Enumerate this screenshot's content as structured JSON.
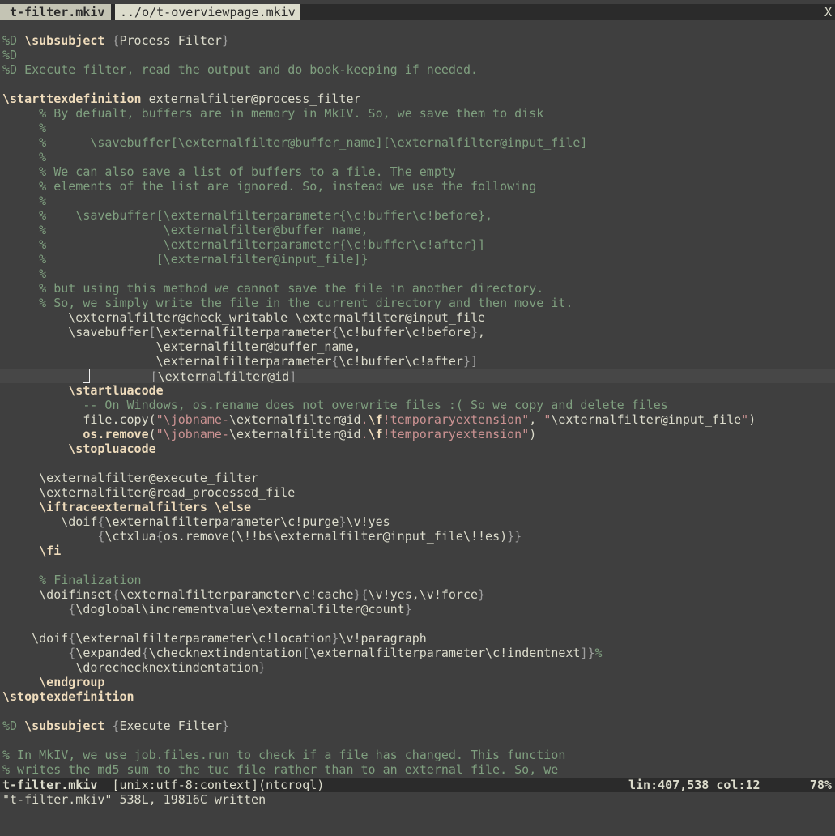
{
  "tabs": [
    {
      "label": "t-filter.mkiv",
      "active": true
    },
    {
      "label": "../o/t-overviewpage.mkiv",
      "active": false
    }
  ],
  "tab_close_label": "X",
  "colors": {
    "background": "#3f3f3f",
    "foreground": "#dcdccc",
    "comment": "#7f9f7f",
    "keyword": "#efdcbc",
    "string": "#cc9393",
    "statusline_bg": "#2b2b2b"
  },
  "lines": [
    [
      {
        "t": "%D ",
        "c": "cmt"
      },
      {
        "t": "\\subsubject",
        "c": "kw"
      },
      {
        "t": " "
      },
      {
        "t": "{",
        "c": "br"
      },
      {
        "t": "Process Filter"
      },
      {
        "t": "}",
        "c": "br"
      }
    ],
    [
      {
        "t": "%D",
        "c": "cmt"
      }
    ],
    [
      {
        "t": "%D Execute filter, read the output and do book-keeping if needed.",
        "c": "cmt"
      }
    ],
    [],
    [
      {
        "t": "\\starttexdefinition",
        "c": "kw"
      },
      {
        "t": " externalfilter@process_filter"
      }
    ],
    [
      {
        "t": "     % By defualt, buffers are in memory in MkIV. So, we save them to disk",
        "c": "cmt"
      }
    ],
    [
      {
        "t": "     %",
        "c": "cmt"
      }
    ],
    [
      {
        "t": "     %      \\savebuffer[\\externalfilter@buffer_name][\\externalfilter@input_file]",
        "c": "cmt"
      }
    ],
    [
      {
        "t": "     %",
        "c": "cmt"
      }
    ],
    [
      {
        "t": "     % We can also save a list of buffers to a file. The empty",
        "c": "cmt"
      }
    ],
    [
      {
        "t": "     % elements of the list are ignored. So, instead we use the following",
        "c": "cmt"
      }
    ],
    [
      {
        "t": "     %",
        "c": "cmt"
      }
    ],
    [
      {
        "t": "     %    \\savebuffer[\\externalfilterparameter{\\c!buffer\\c!before},",
        "c": "cmt"
      }
    ],
    [
      {
        "t": "     %                \\externalfilter@buffer_name,",
        "c": "cmt"
      }
    ],
    [
      {
        "t": "     %                \\externalfilterparameter{\\c!buffer\\c!after}]",
        "c": "cmt"
      }
    ],
    [
      {
        "t": "     %               [\\externalfilter@input_file]}",
        "c": "cmt"
      }
    ],
    [
      {
        "t": "     %",
        "c": "cmt"
      }
    ],
    [
      {
        "t": "     % but using this method we cannot save the file in another directory.",
        "c": "cmt"
      }
    ],
    [
      {
        "t": "     % So, we simply write the file in the current directory and then move it.",
        "c": "cmt"
      }
    ],
    [
      {
        "t": "         \\externalfilter@check_writable \\externalfilter@input_file"
      }
    ],
    [
      {
        "t": "         \\savebuffer"
      },
      {
        "t": "[",
        "c": "br"
      },
      {
        "t": "\\externalfilterparameter"
      },
      {
        "t": "{",
        "c": "br"
      },
      {
        "t": "\\c!buffer\\c!before"
      },
      {
        "t": "}",
        "c": "br"
      },
      {
        "t": ","
      }
    ],
    [
      {
        "t": "                     \\externalfilter@buffer_name,"
      }
    ],
    [
      {
        "t": "                     \\externalfilterparameter"
      },
      {
        "t": "{",
        "c": "br"
      },
      {
        "t": "\\c!buffer\\c!after"
      },
      {
        "t": "}]",
        "c": "br"
      }
    ],
    [
      {
        "t": "           ",
        "cursor": true
      },
      {
        "t": "        "
      },
      {
        "t": "[",
        "c": "br"
      },
      {
        "t": "\\externalfilter@id"
      },
      {
        "t": "]",
        "c": "br"
      }
    ],
    [
      {
        "t": "         "
      },
      {
        "t": "\\startluacode",
        "c": "kw"
      }
    ],
    [
      {
        "t": "           -- On Windows, os.rename does not overwrite files :( So we copy and delete files",
        "c": "cmt"
      }
    ],
    [
      {
        "t": "           file.copy("
      },
      {
        "t": "\"\\jobname-",
        "c": "str"
      },
      {
        "t": "\\externalfilter@id"
      },
      {
        "t": ".",
        "c": "str"
      },
      {
        "t": "\\f",
        "c": "lua"
      },
      {
        "t": "!temporaryextension\"",
        "c": "str"
      },
      {
        "t": ", "
      },
      {
        "t": "\"",
        "c": "str"
      },
      {
        "t": "\\externalfilter@input_file"
      },
      {
        "t": "\"",
        "c": "str"
      },
      {
        "t": ")"
      }
    ],
    [
      {
        "t": "           "
      },
      {
        "t": "os.remove",
        "c": "lua"
      },
      {
        "t": "("
      },
      {
        "t": "\"\\jobname-",
        "c": "str"
      },
      {
        "t": "\\externalfilter@id"
      },
      {
        "t": ".",
        "c": "str"
      },
      {
        "t": "\\f",
        "c": "lua"
      },
      {
        "t": "!temporaryextension\"",
        "c": "str"
      },
      {
        "t": ")"
      }
    ],
    [
      {
        "t": "         "
      },
      {
        "t": "\\stopluacode",
        "c": "kw"
      }
    ],
    [],
    [
      {
        "t": "     \\externalfilter@execute_filter"
      }
    ],
    [
      {
        "t": "     \\externalfilter@read_processed_file"
      }
    ],
    [
      {
        "t": "     "
      },
      {
        "t": "\\iftraceexternalfilters \\else",
        "c": "kw"
      }
    ],
    [
      {
        "t": "        \\doif"
      },
      {
        "t": "{",
        "c": "br"
      },
      {
        "t": "\\externalfilterparameter\\c!purge"
      },
      {
        "t": "}",
        "c": "br"
      },
      {
        "t": "\\v!yes"
      }
    ],
    [
      {
        "t": "             "
      },
      {
        "t": "{",
        "c": "br"
      },
      {
        "t": "\\ctxlua"
      },
      {
        "t": "{",
        "c": "br"
      },
      {
        "t": "os.remove(\\!!bs\\externalfilter@input_file\\!!es)"
      },
      {
        "t": "}}",
        "c": "br"
      }
    ],
    [
      {
        "t": "     "
      },
      {
        "t": "\\fi",
        "c": "kw"
      }
    ],
    [],
    [
      {
        "t": "     % Finalization",
        "c": "cmt"
      }
    ],
    [
      {
        "t": "     \\doifinset"
      },
      {
        "t": "{",
        "c": "br"
      },
      {
        "t": "\\externalfilterparameter\\c!cache"
      },
      {
        "t": "}{",
        "c": "br"
      },
      {
        "t": "\\v!yes,\\v!force"
      },
      {
        "t": "}",
        "c": "br"
      }
    ],
    [
      {
        "t": "         "
      },
      {
        "t": "{",
        "c": "br"
      },
      {
        "t": "\\doglobal\\incrementvalue\\externalfilter@count"
      },
      {
        "t": "}",
        "c": "br"
      }
    ],
    [],
    [
      {
        "t": "    \\doif"
      },
      {
        "t": "{",
        "c": "br"
      },
      {
        "t": "\\externalfilterparameter\\c!location"
      },
      {
        "t": "}",
        "c": "br"
      },
      {
        "t": "\\v!paragraph"
      }
    ],
    [
      {
        "t": "         "
      },
      {
        "t": "{",
        "c": "br"
      },
      {
        "t": "\\expanded"
      },
      {
        "t": "{",
        "c": "br"
      },
      {
        "t": "\\checknextindentation"
      },
      {
        "t": "[",
        "c": "br"
      },
      {
        "t": "\\externalfilterparameter\\c!indentnext"
      },
      {
        "t": "]}",
        "c": "br"
      },
      {
        "t": "%",
        "c": "cmt"
      }
    ],
    [
      {
        "t": "          \\dorechecknextindentation"
      },
      {
        "t": "}",
        "c": "br"
      }
    ],
    [
      {
        "t": "     "
      },
      {
        "t": "\\endgroup",
        "c": "kw"
      }
    ],
    [
      {
        "t": "\\stoptexdefinition",
        "c": "kw"
      }
    ],
    [],
    [
      {
        "t": "%D ",
        "c": "cmt"
      },
      {
        "t": "\\subsubject",
        "c": "kw"
      },
      {
        "t": " "
      },
      {
        "t": "{",
        "c": "br"
      },
      {
        "t": "Execute Filter"
      },
      {
        "t": "}",
        "c": "br"
      }
    ],
    [],
    [
      {
        "t": "% In MkIV, we use job.files.run to check if a file has changed. This function",
        "c": "cmt"
      }
    ],
    [
      {
        "t": "% writes the md5 sum to the tuc file rather than to an external file. So, we",
        "c": "cmt"
      }
    ]
  ],
  "cursor_line_index": 23,
  "status": {
    "filename": "t-filter.mkiv",
    "flags": "  [unix:utf-8:context](ntcroql)",
    "position": "lin:407,538 col:12",
    "percent": "78%"
  },
  "command_line": "\"t-filter.mkiv\" 538L, 19816C written"
}
